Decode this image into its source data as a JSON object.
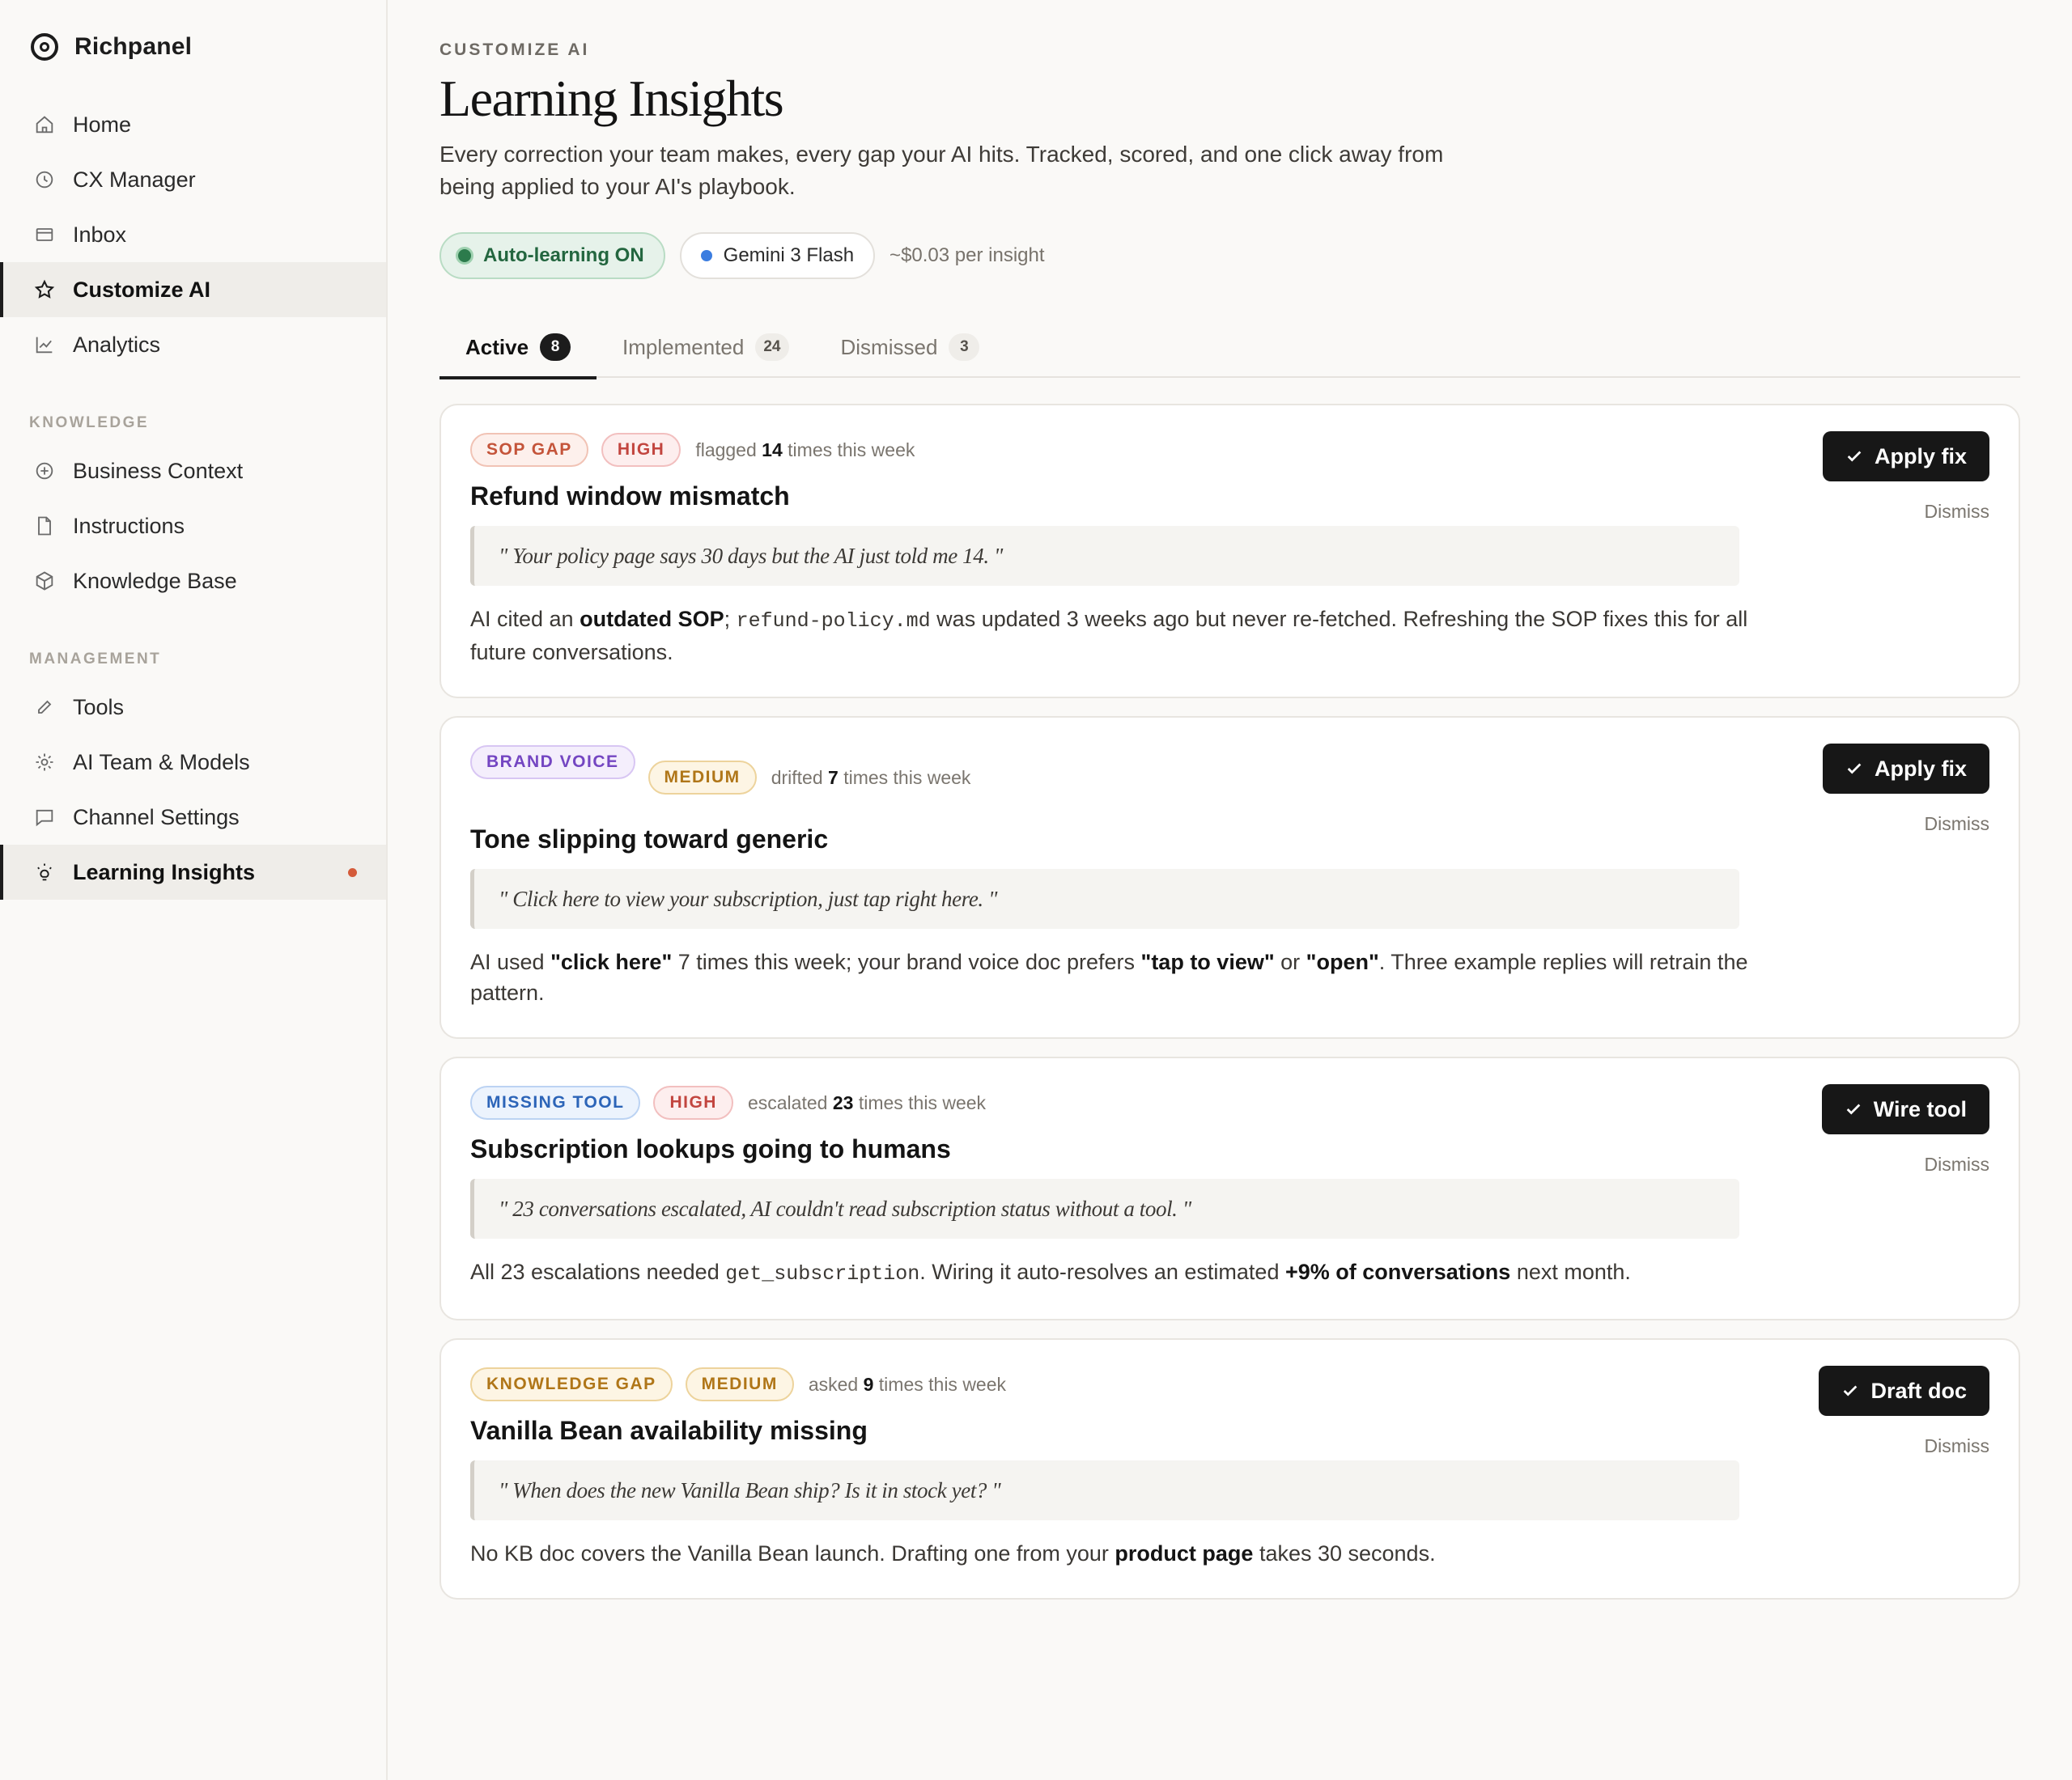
{
  "app": {
    "name": "Richpanel",
    "logo_icon": "target-icon"
  },
  "sidebar": {
    "primary": [
      {
        "label": "Home",
        "icon": "home-icon"
      },
      {
        "label": "CX Manager",
        "icon": "clock-icon"
      },
      {
        "label": "Inbox",
        "icon": "inbox-icon"
      },
      {
        "label": "Customize AI",
        "icon": "star-icon",
        "active": true
      },
      {
        "label": "Analytics",
        "icon": "chart-icon"
      }
    ],
    "knowledge_label": "KNOWLEDGE",
    "knowledge": [
      {
        "label": "Business Context",
        "icon": "plus-circle-icon"
      },
      {
        "label": "Instructions",
        "icon": "document-icon"
      },
      {
        "label": "Knowledge Base",
        "icon": "cube-icon"
      }
    ],
    "management_label": "MANAGEMENT",
    "management": [
      {
        "label": "Tools",
        "icon": "pencil-icon"
      },
      {
        "label": "AI Team & Models",
        "icon": "gear-icon"
      },
      {
        "label": "Channel Settings",
        "icon": "chat-icon"
      },
      {
        "label": "Learning Insights",
        "icon": "lightbulb-icon",
        "active": true,
        "has_dot": true
      }
    ]
  },
  "header": {
    "eyebrow": "CUSTOMIZE AI",
    "title": "Learning Insights",
    "description": "Every correction your team makes, every gap your AI hits. Tracked, scored, and one click away from being applied to your AI's playbook.",
    "chips": {
      "auto_learning": "Auto-learning ON",
      "model": "Gemini 3 Flash",
      "cost": "~$0.03 per insight"
    }
  },
  "tabs": [
    {
      "label": "Active",
      "count": "8",
      "active": true
    },
    {
      "label": "Implemented",
      "count": "24"
    },
    {
      "label": "Dismissed",
      "count": "3"
    }
  ],
  "insights": [
    {
      "category": "SOP GAP",
      "severity": "HIGH",
      "meta_prefix": "flagged",
      "meta_count": "14",
      "meta_suffix": "times this week",
      "title": "Refund window mismatch",
      "quote": "\" Your policy page says 30 days but the AI just told me 14. \"",
      "desc": [
        "AI cited an ",
        "outdated SOP",
        "; ",
        "refund-policy.md",
        " was updated 3 weeks ago but never re-fetched. Refreshing the SOP fixes this for all future conversations."
      ],
      "action": "Apply fix",
      "dismiss": "Dismiss"
    },
    {
      "category": "BRAND VOICE",
      "severity": "MEDIUM",
      "meta_prefix": "drifted",
      "meta_count": "7",
      "meta_suffix": "times this week",
      "title": "Tone slipping toward generic",
      "quote": "\" Click here to view your subscription, just tap right here. \"",
      "desc": [
        "AI used ",
        "\"click here\"",
        " 7 times this week; your brand voice doc prefers ",
        "\"tap to view\"",
        " or ",
        "\"open\"",
        ". Three example replies will retrain the pattern."
      ],
      "action": "Apply fix",
      "dismiss": "Dismiss"
    },
    {
      "category": "MISSING TOOL",
      "severity": "HIGH",
      "meta_prefix": "escalated",
      "meta_count": "23",
      "meta_suffix": "times this week",
      "title": "Subscription lookups going to humans",
      "quote": "\" 23 conversations escalated, AI couldn't read subscription status without a tool. \"",
      "desc": [
        "All 23 escalations needed ",
        "get_subscription",
        ". Wiring it auto-resolves an estimated ",
        "+9% of conversations",
        " next month."
      ],
      "action": "Wire tool",
      "dismiss": "Dismiss"
    },
    {
      "category": "KNOWLEDGE GAP",
      "severity": "MEDIUM",
      "meta_prefix": "asked",
      "meta_count": "9",
      "meta_suffix": "times this week",
      "title": "Vanilla Bean availability missing",
      "quote": "\" When does the new Vanilla Bean ship? Is it in stock yet? \"",
      "desc": [
        "No KB doc covers the Vanilla Bean launch. Drafting one from your ",
        "product page",
        " takes 30 seconds."
      ],
      "action": "Draft doc",
      "dismiss": "Dismiss"
    }
  ]
}
